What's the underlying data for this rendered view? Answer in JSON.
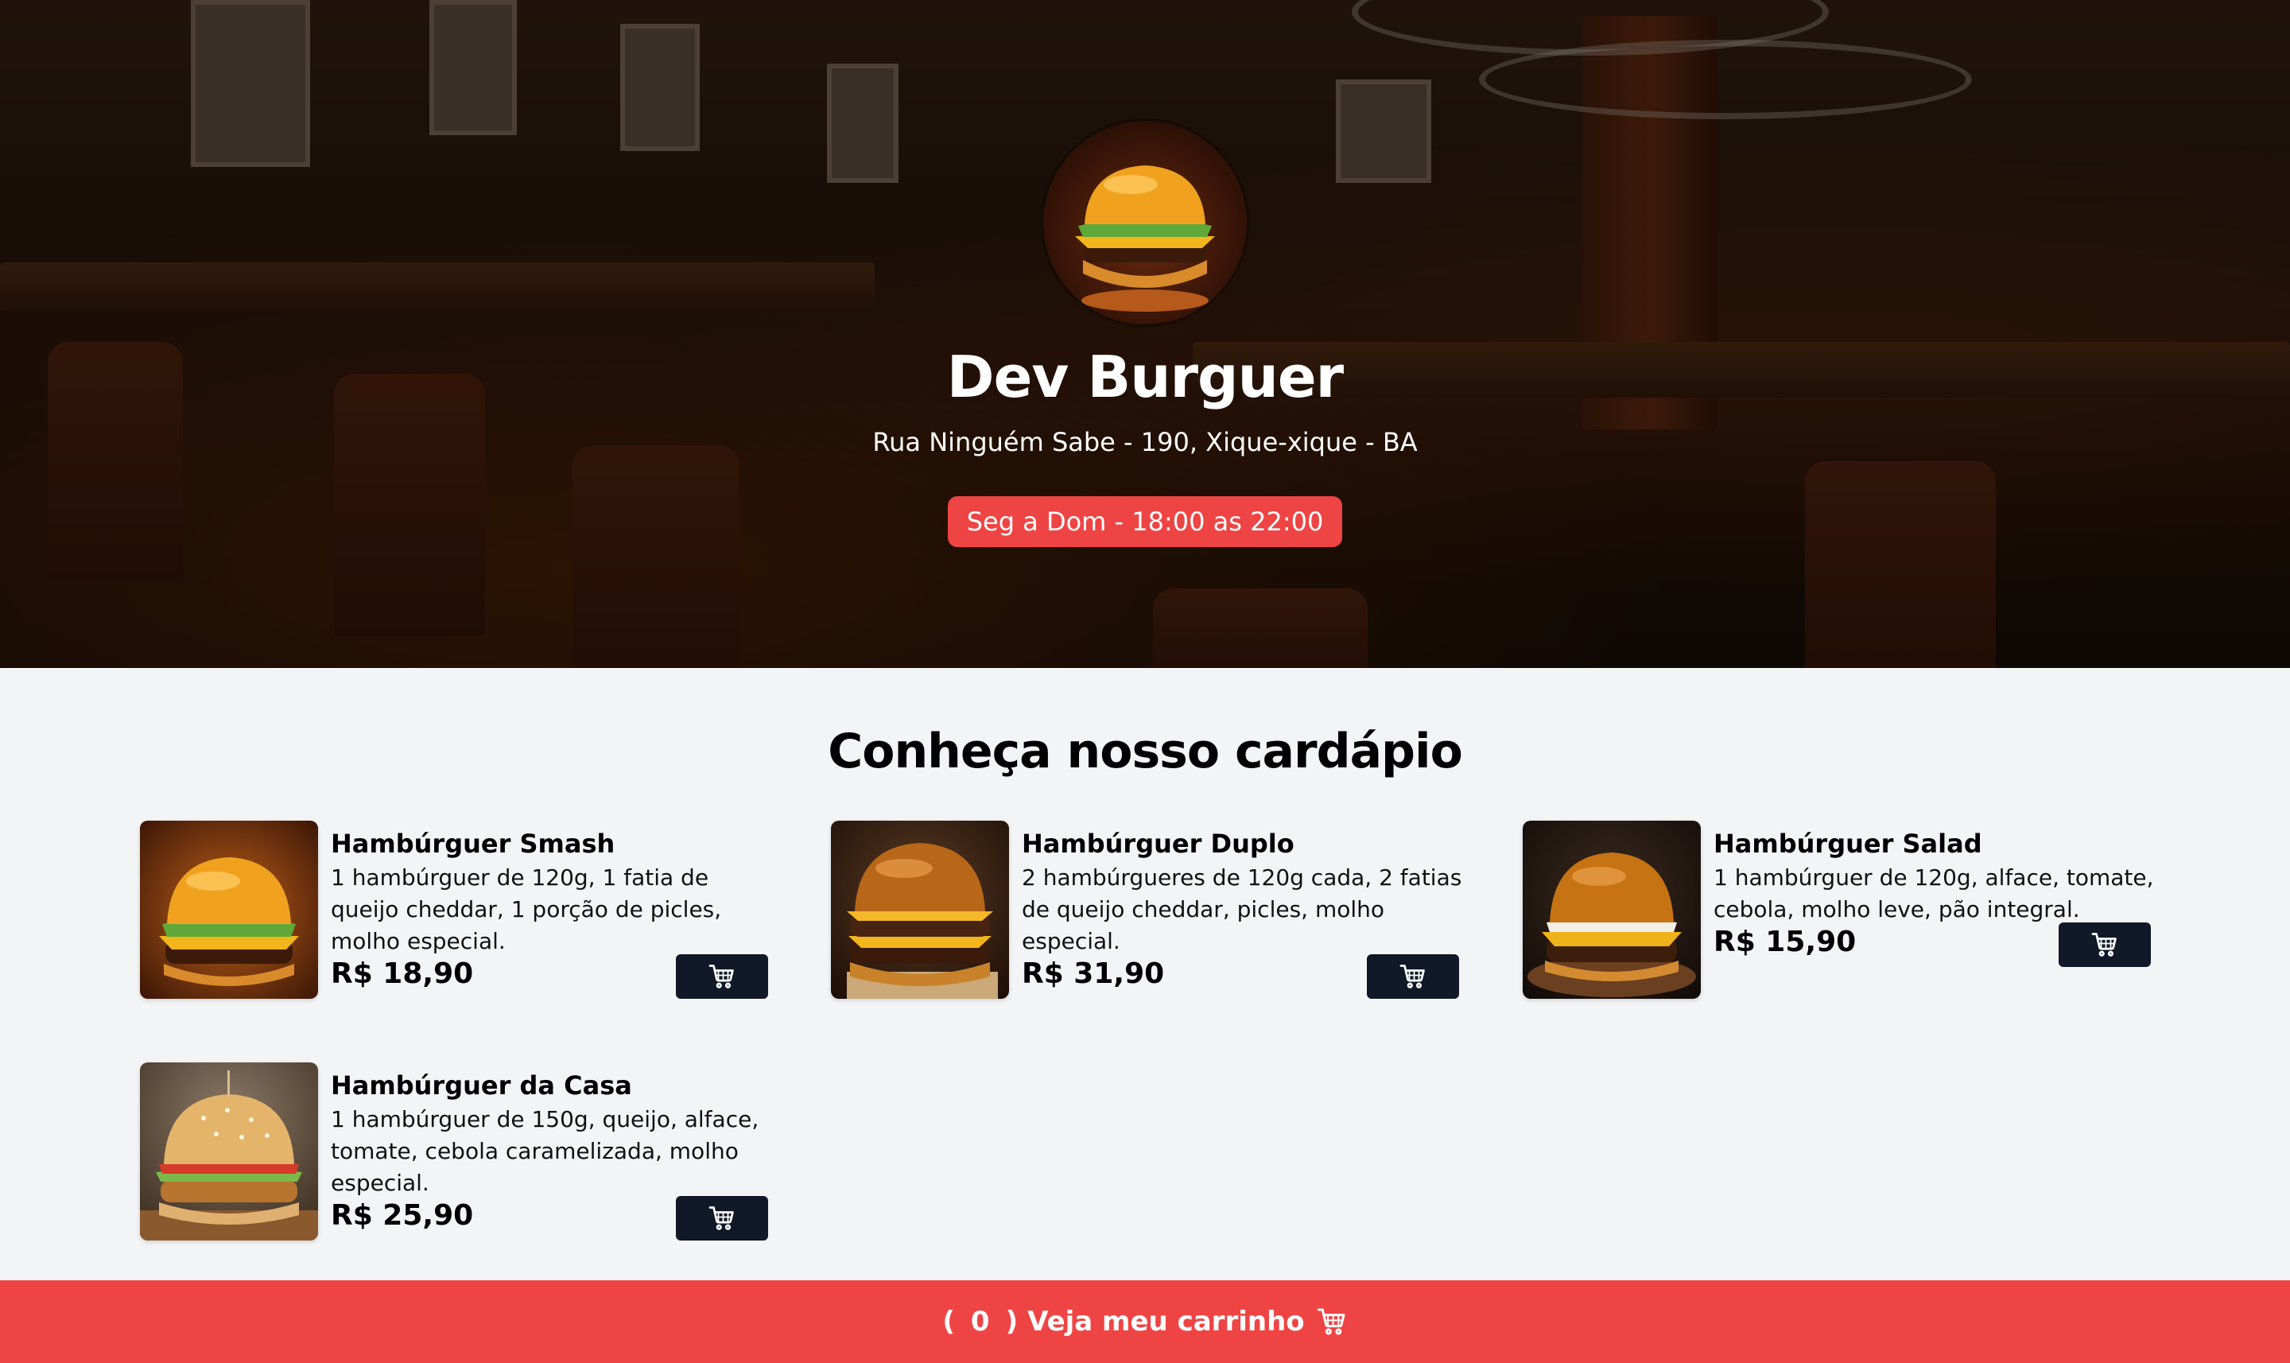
{
  "hero": {
    "title": "Dev Burguer",
    "address": "Rua Ninguém Sabe - 190, Xique-xique - BA",
    "hours": "Seg a Dom - 18:00 as 22:00"
  },
  "menu": {
    "title": "Conheça nosso cardápio",
    "items": [
      {
        "name": "Hambúrguer Smash",
        "description": "1 hambúrguer de 120g, 1 fatia de queijo cheddar, 1 porção de picles, molho especial.",
        "price": "R$ 18,90"
      },
      {
        "name": "Hambúrguer Duplo",
        "description": "2 hambúrgueres de 120g cada, 2 fatias de queijo cheddar, picles, molho especial.",
        "price": "R$ 31,90"
      },
      {
        "name": "Hambúrguer Salad",
        "description": "1 hambúrguer de 120g, alface, tomate, cebola, molho leve, pão integral.",
        "price": "R$ 15,90"
      },
      {
        "name": "Hambúrguer da Casa",
        "description": "1 hambúrguer de 150g, queijo, alface, tomate, cebola caramelizada, molho especial.",
        "price": "R$ 25,90"
      }
    ]
  },
  "cart": {
    "open_paren": "(",
    "count": "0",
    "close_paren": ")",
    "label": "Veja meu carrinho"
  },
  "colors": {
    "accent": "#ef4444",
    "button_dark": "#111827",
    "page_bg": "#f3f4f6"
  },
  "icons": {
    "add_to_cart": "shopping-cart-icon",
    "footer_cart": "shopping-cart-icon"
  }
}
